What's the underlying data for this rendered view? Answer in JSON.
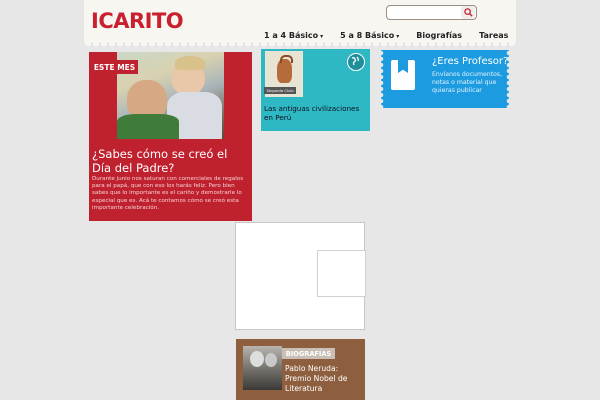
{
  "header": {
    "logo": "ICARITO",
    "search": {
      "placeholder": ""
    },
    "nav": [
      {
        "label": "1 a 4 Básico",
        "dropdown": true
      },
      {
        "label": "5 a 8 Básico",
        "dropdown": true
      },
      {
        "label": "Biografías",
        "dropdown": false
      },
      {
        "label": "Tareas",
        "dropdown": false
      }
    ],
    "nav_caret": "▾"
  },
  "feature_red": {
    "badge": "ESTE MES",
    "title": "¿Sabes cómo se creó el Día del Padre?",
    "description": "Durante junio nos saturan con comerciales de regalos para el papá, que con eso los harás feliz. Pero bien sabes que lo importante es el cariño y demostrarle lo especial que es. Acá te contamos cómo se creó esta importante celebración.",
    "color": "#c0212f"
  },
  "feature_teal": {
    "tag": "Segundo Ciclo",
    "title": "Las antiguas civilizaciones en Perú",
    "color": "#2eb8c4",
    "icon": "globe-icon"
  },
  "feature_blue": {
    "title": "¿Eres Profesor?",
    "description": "Envíanos documentos, notas o material que quieras publicar",
    "color": "#1d9be0",
    "icon": "book-icon"
  },
  "feature_brown": {
    "badge": "BIOGRAFÍAS",
    "title": "Pablo Neruda: Premio Nobel de Literatura",
    "color": "#8d5f3f"
  }
}
